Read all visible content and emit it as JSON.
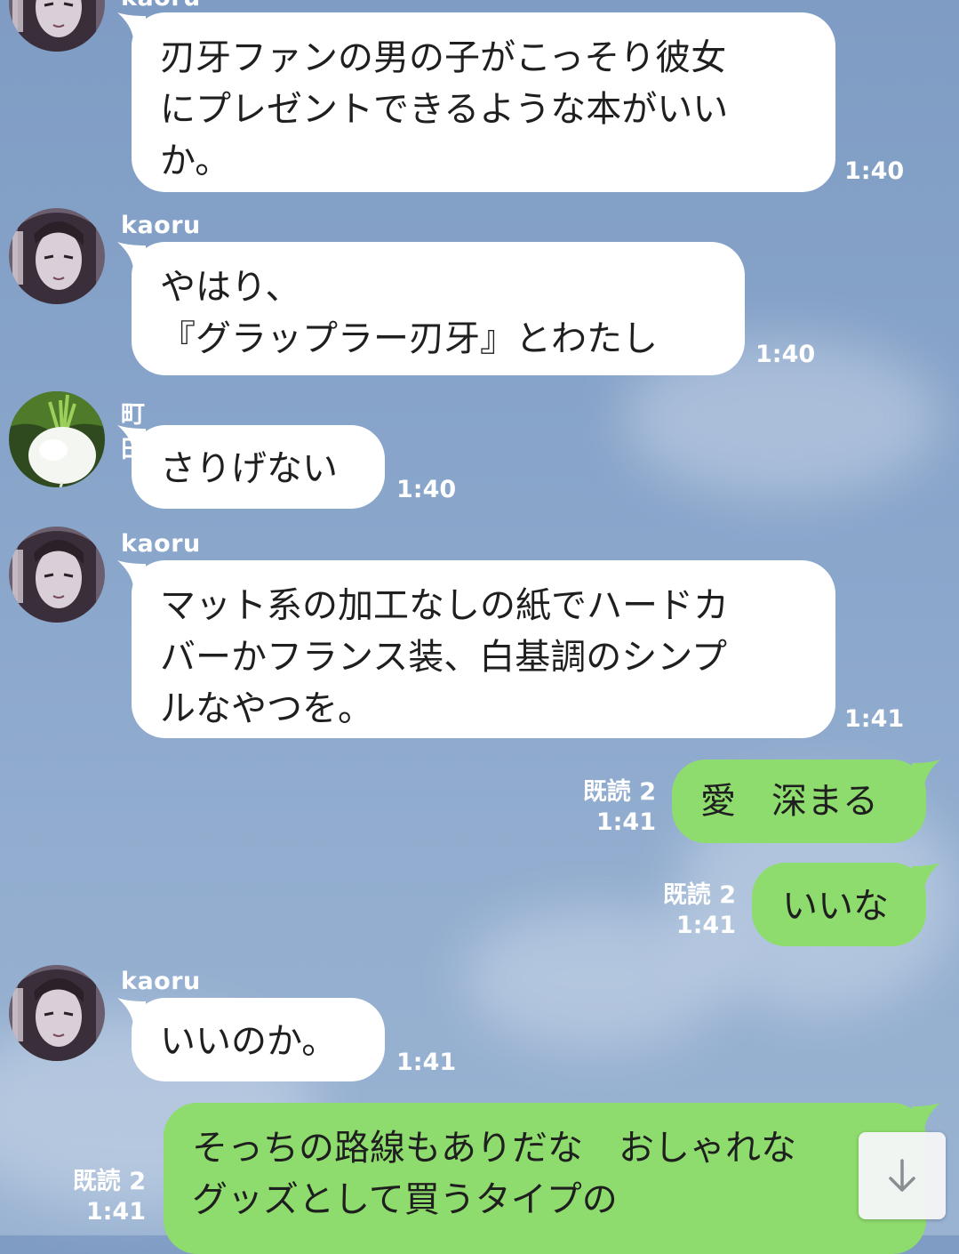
{
  "chat": {
    "messages": [
      {
        "sender": "kaoru",
        "avatar": "kaoru-avatar",
        "text": "刃牙ファンの男の子がこっそり彼女\nにプレゼントできるような本がいい\nか。",
        "time": "1:40"
      },
      {
        "sender": "kaoru",
        "avatar": "kaoru-avatar",
        "text": "やはり、\n『グラップラー刃牙』とわたし",
        "time": "1:40"
      },
      {
        "sender": "町田",
        "avatar": "turnip-avatar",
        "text": "さりげない",
        "time": "1:40"
      },
      {
        "sender": "kaoru",
        "avatar": "kaoru-avatar",
        "text": "マット系の加工なしの紙でハードカ\nバーかフランス装、白基調のシンプ\nルなやつを。",
        "time": "1:41"
      },
      {
        "sender": "me",
        "text": "愛　深まる",
        "read": "既読 2",
        "time": "1:41"
      },
      {
        "sender": "me",
        "text": "いいな",
        "read": "既読 2",
        "time": "1:41"
      },
      {
        "sender": "kaoru",
        "avatar": "kaoru-avatar",
        "text": "いいのか。",
        "time": "1:41"
      },
      {
        "sender": "me",
        "text": "そっちの路線もありだな　おしゃれな\nグッズとして買うタイプの",
        "read": "既読 2",
        "time": "1:41"
      }
    ],
    "scroll_button_icon": "arrow-down-icon",
    "colors": {
      "background": "#8aa6cb",
      "incoming_bubble": "#ffffff",
      "outgoing_bubble": "#8fdc6e",
      "meta_text": "#ffffff"
    }
  }
}
